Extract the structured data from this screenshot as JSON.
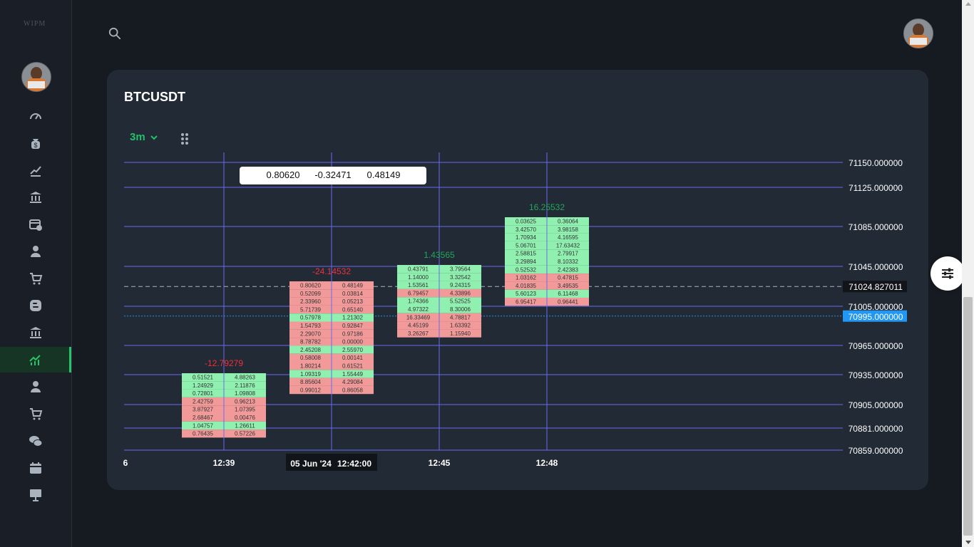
{
  "sidebar": {
    "logo_text": "WIPM",
    "items": [
      {
        "icon": "dashboard-gauge-icon"
      },
      {
        "icon": "money-bag-icon"
      },
      {
        "icon": "trending-chart-icon"
      },
      {
        "icon": "bank-icon"
      },
      {
        "icon": "calendar-check-icon"
      },
      {
        "icon": "user-icon"
      },
      {
        "icon": "cart-icon"
      },
      {
        "icon": "blogger-icon"
      },
      {
        "icon": "bank-icon"
      },
      {
        "icon": "trading-chart-icon",
        "active": true
      },
      {
        "icon": "user-icon"
      },
      {
        "icon": "cart-icon"
      },
      {
        "icon": "chat-icon"
      },
      {
        "icon": "calendar-icon"
      },
      {
        "icon": "presentation-icon"
      }
    ]
  },
  "topbar": {
    "search_icon": "search-icon"
  },
  "card": {
    "title": "BTCUSDT",
    "timeframe": "3m"
  },
  "colors": {
    "accent": "#21c16b",
    "buy": "#90f0b0",
    "sell": "#f29a9a",
    "grid": "#6a6af0",
    "price_label_bg": "#2196f3"
  },
  "chart_data": {
    "type": "table",
    "tooltip": [
      "0.80620",
      "-0.32471",
      "0.48149"
    ],
    "price_levels": [
      "71150.000000",
      "71125.000000",
      "71085.000000",
      "71045.000000",
      "71024.827011",
      "71005.000000",
      "70995.000000",
      "70965.000000",
      "70935.000000",
      "70905.000000",
      "70881.000000",
      "70859.000000"
    ],
    "current_price": "70995.000000",
    "crosshair_price": "71024.827011",
    "time_labels": [
      "6",
      "12:39",
      "05 Jun '24",
      "12:42:00",
      "12:45",
      "12:48"
    ],
    "candles": [
      {
        "time": "12:39",
        "delta": "-12.79279",
        "delta_sign": "neg",
        "rows": [
          [
            "0.51521",
            "4.88263",
            "buy"
          ],
          [
            "1.24929",
            "2.11876",
            "buy"
          ],
          [
            "0.72801",
            "1.09808",
            "buy"
          ],
          [
            "2.42759",
            "0.96213",
            "sell"
          ],
          [
            "3.87927",
            "1.07395",
            "sell"
          ],
          [
            "2.68467",
            "0.00476",
            "sell"
          ],
          [
            "1.04757",
            "1.26611",
            "buy"
          ],
          [
            "0.76435",
            "0.57226",
            "sell"
          ]
        ]
      },
      {
        "time": "12:42",
        "delta": "-24.14532",
        "delta_sign": "neg",
        "rows": [
          [
            "0.80620",
            "0.48149",
            "sell"
          ],
          [
            "0.52099",
            "0.03814",
            "sell"
          ],
          [
            "2.33960",
            "0.05213",
            "sell"
          ],
          [
            "5.71739",
            "0.65140",
            "sell"
          ],
          [
            "0.57978",
            "1.21302",
            "buy"
          ],
          [
            "1.54793",
            "0.92847",
            "sell"
          ],
          [
            "2.29070",
            "0.97186",
            "sell"
          ],
          [
            "8.78782",
            "0.00000",
            "sell"
          ],
          [
            "2.45208",
            "2.55970",
            "buy"
          ],
          [
            "0.58008",
            "0.00141",
            "sell"
          ],
          [
            "1.80214",
            "0.61521",
            "sell"
          ],
          [
            "1.09319",
            "1.55449",
            "buy"
          ],
          [
            "8.85604",
            "4.29084",
            "sell"
          ],
          [
            "0.99012",
            "0.86058",
            "sell"
          ]
        ]
      },
      {
        "time": "12:45",
        "delta": "1.43565",
        "delta_sign": "pos",
        "rows": [
          [
            "0.43791",
            "3.79564",
            "buy"
          ],
          [
            "1.14000",
            "3.32542",
            "buy"
          ],
          [
            "1.53561",
            "9.24315",
            "buy"
          ],
          [
            "6.79457",
            "4.33896",
            "sell"
          ],
          [
            "1.74366",
            "5.52525",
            "buy"
          ],
          [
            "4.97322",
            "8.30006",
            "buy"
          ],
          [
            "16.33469",
            "4.78817",
            "sell"
          ],
          [
            "4.45199",
            "1.63392",
            "sell"
          ],
          [
            "3.26267",
            "1.15940",
            "sell"
          ]
        ]
      },
      {
        "time": "12:48",
        "delta": "16.25532",
        "delta_sign": "pos",
        "rows": [
          [
            "0.03625",
            "0.36064",
            "buy"
          ],
          [
            "3.42570",
            "3.98158",
            "buy"
          ],
          [
            "1.70934",
            "4.16595",
            "buy"
          ],
          [
            "5.06701",
            "17.63432",
            "buy"
          ],
          [
            "2.58815",
            "2.79917",
            "buy"
          ],
          [
            "3.29894",
            "8.10332",
            "buy"
          ],
          [
            "0.52532",
            "2.42383",
            "buy"
          ],
          [
            "1.03162",
            "0.47815",
            "sell"
          ],
          [
            "4.01835",
            "3.49535",
            "sell"
          ],
          [
            "5.60123",
            "6.11468",
            "buy"
          ],
          [
            "6.95417",
            "0.96441",
            "sell"
          ]
        ]
      }
    ]
  }
}
